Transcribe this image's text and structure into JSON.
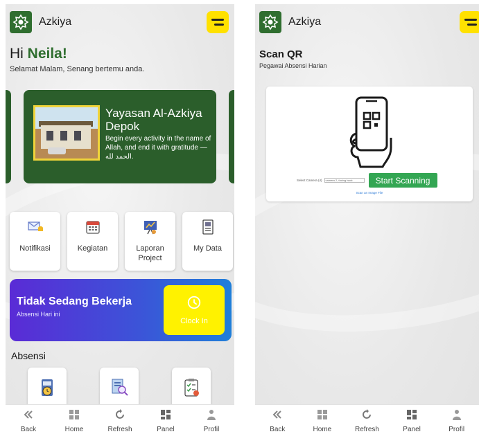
{
  "app": {
    "name": "Azkiya"
  },
  "colors": {
    "brand_green": "#2f6e2f",
    "accent_yellow": "#ffe100",
    "scan_green": "#33a653"
  },
  "home": {
    "greeting_prefix": "Hi ",
    "greeting_name": "Neila!",
    "subgreeting": "Selamat Malam, Senang bertemu anda.",
    "banner": {
      "title": "Yayasan Al-Azkiya Depok",
      "subtitle": "Begin every activity in the name of Allah, and end it with gratitude — الحمد لله."
    },
    "menu": [
      {
        "label": "Notifikasi",
        "icon": "envelope-bell-icon"
      },
      {
        "label": "Kegiatan",
        "icon": "calendar-icon"
      },
      {
        "label": "Laporan\nProject",
        "icon": "report-board-icon"
      },
      {
        "label": "My Data",
        "icon": "document-icon"
      }
    ],
    "work_card": {
      "title": "Tidak Sedang Bekerja",
      "subtitle": "Absensi Hari ini",
      "button_label": "Clock In"
    },
    "absensi_section": {
      "title": "Absensi"
    }
  },
  "scan": {
    "title": "Scan QR",
    "subtitle": "Pegawai Absensi Harian",
    "camera_label": "Select Camera (4)",
    "camera_value": "camera 2, facing back",
    "start_button": "Start Scanning",
    "scan_file_link": "Scan an Image File"
  },
  "bottom_nav": {
    "items": [
      {
        "label": "Back",
        "icon": "back-icon"
      },
      {
        "label": "Home",
        "icon": "home-icon"
      },
      {
        "label": "Refresh",
        "icon": "refresh-icon"
      },
      {
        "label": "Panel",
        "icon": "panel-icon"
      },
      {
        "label": "Profil",
        "icon": "profile-icon"
      }
    ]
  }
}
